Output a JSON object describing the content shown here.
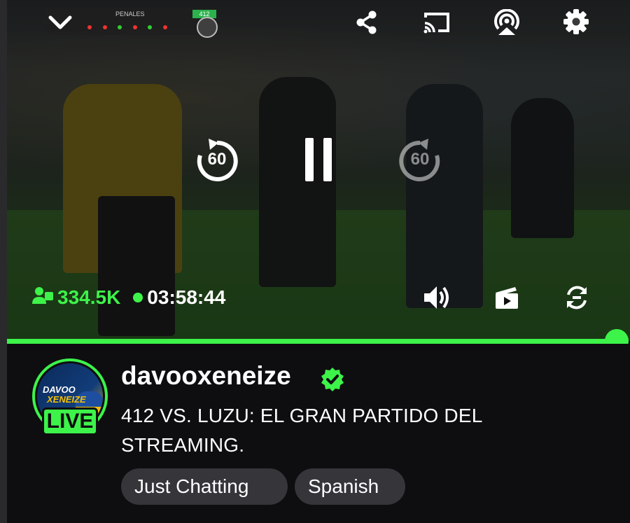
{
  "video": {
    "scoreboard": {
      "label": "PENALES",
      "score": "412"
    },
    "viewers": "334.5K",
    "elapsed": "03:58:44",
    "rewind_seconds": "60",
    "forward_seconds": "60",
    "progress": 1.0
  },
  "icons": {
    "collapse": "chevron-down-icon",
    "share": "share-icon",
    "cast": "cast-icon",
    "airplay": "airplay-icon",
    "settings": "gear-icon",
    "rewind": "rewind-60-icon",
    "pause": "pause-icon",
    "forward": "forward-60-icon",
    "viewers": "viewers-icon",
    "volume": "volume-icon",
    "clip": "clip-icon",
    "rotate": "rotate-icon",
    "verified": "verified-icon"
  },
  "channel": {
    "name": "davooxeneize",
    "avatar_line1": "DAVOO",
    "avatar_line2": "XENEIZE",
    "live_label": "LIVE",
    "stream_title": "412 VS. LUZU: EL GRAN PARTIDO DEL STREAMING.",
    "tags": [
      "Just Chatting",
      "Spanish"
    ]
  },
  "colors": {
    "accent": "#3df34a",
    "background": "#0e0e10",
    "tag_bg": "#35353a"
  }
}
